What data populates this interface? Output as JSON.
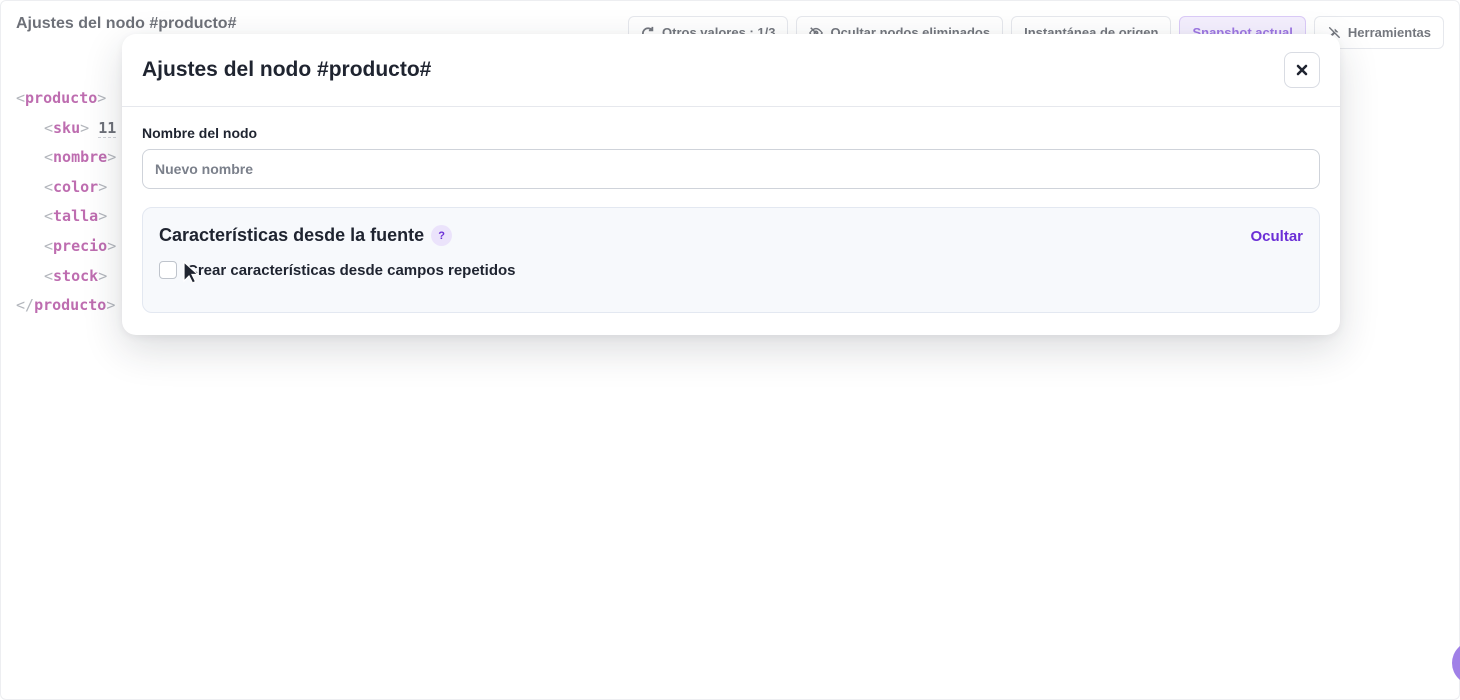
{
  "page": {
    "title": "Ajustes del nodo #producto#"
  },
  "toolbar": {
    "other_values": "Otros valores : 1/3",
    "hide_deleted": "Ocultar nodos eliminados",
    "source_snapshot": "Instantánea de origen",
    "current_snapshot": "Snapshot actual",
    "tools": "Herramientas"
  },
  "code": {
    "root_tag": "producto",
    "children": [
      {
        "tag": "sku",
        "value": "11"
      },
      {
        "tag": "nombre",
        "value": ""
      },
      {
        "tag": "color",
        "value": ""
      },
      {
        "tag": "talla",
        "value": ""
      },
      {
        "tag": "precio",
        "value": ""
      },
      {
        "tag": "stock",
        "value": ""
      }
    ]
  },
  "modal": {
    "title": "Ajustes del nodo #producto#",
    "name_label": "Nombre del nodo",
    "name_placeholder": "Nuevo nombre",
    "name_value": "",
    "panel": {
      "title": "Características desde la fuente",
      "help": "?",
      "hide_link": "Ocultar",
      "checkbox_label": "Crear características desde campos repetidos",
      "checkbox_checked": false
    }
  },
  "colors": {
    "accent": "#6b2fd6",
    "tag": "#9b1f86",
    "active_bg": "#efe6fd"
  }
}
